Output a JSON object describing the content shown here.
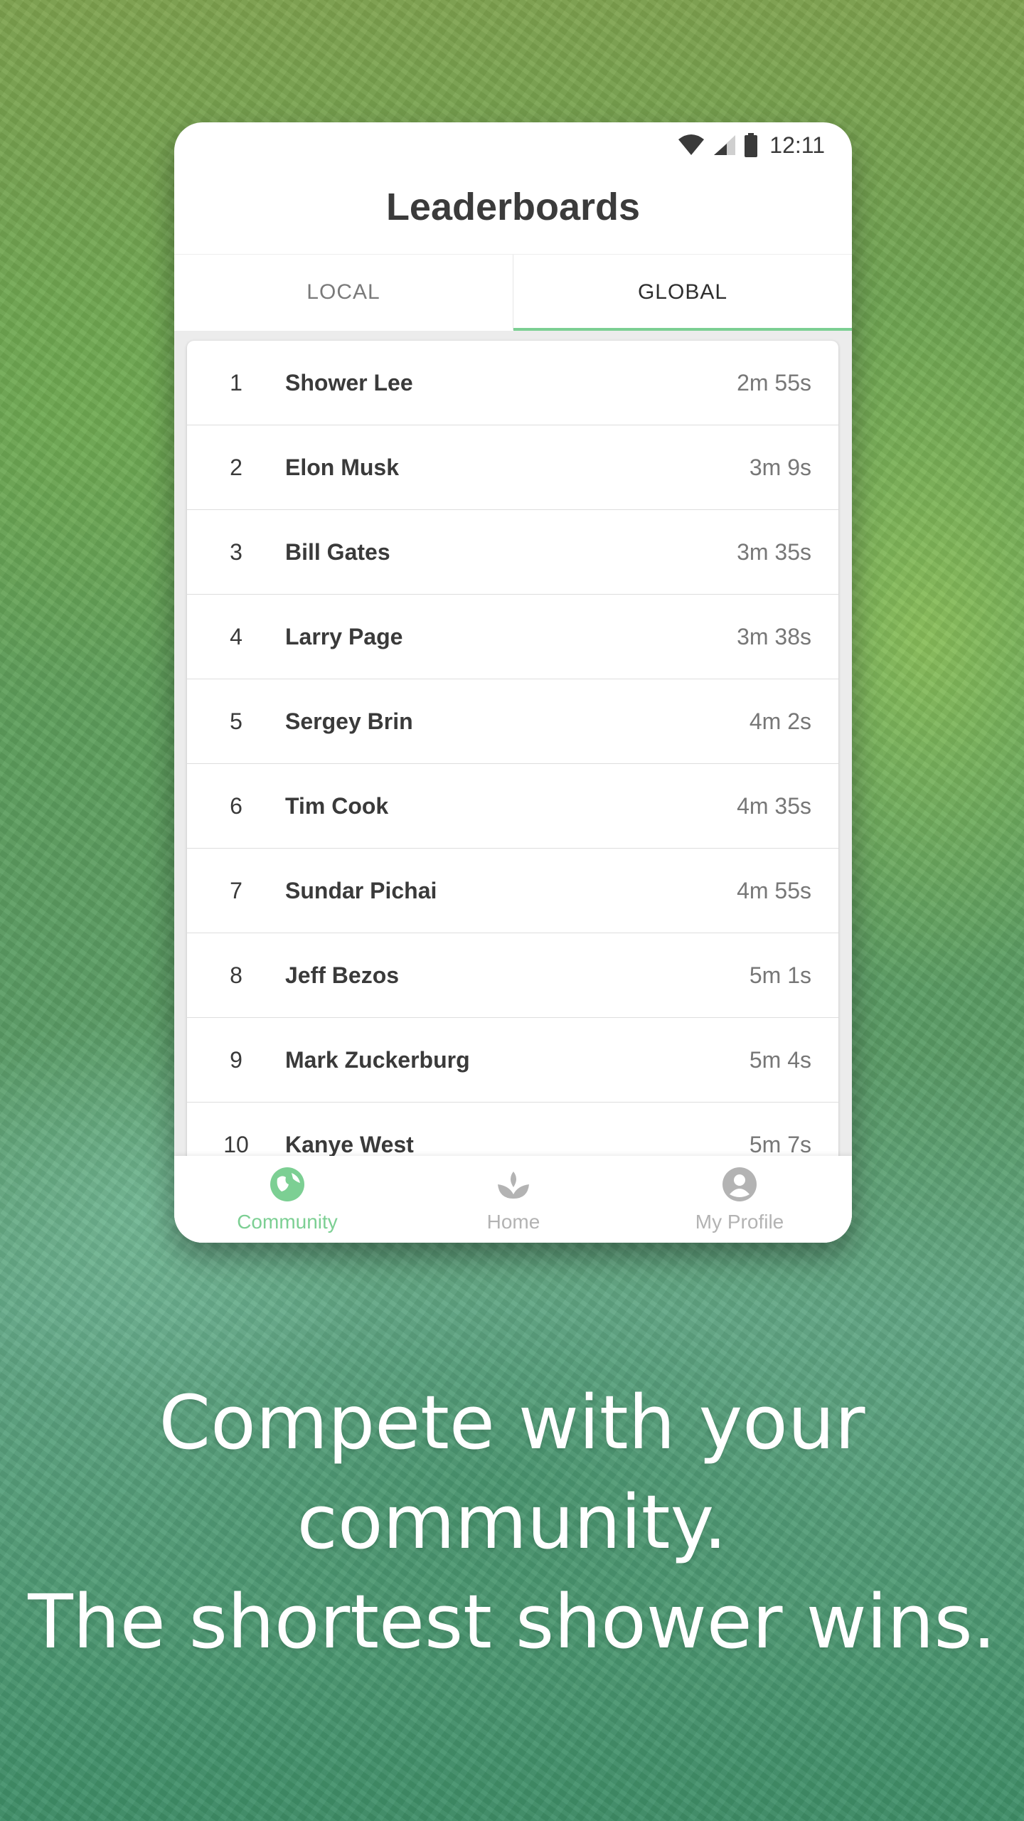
{
  "status_bar": {
    "time": "12:11"
  },
  "header": {
    "title": "Leaderboards"
  },
  "tabs": [
    {
      "label": "LOCAL",
      "active": false
    },
    {
      "label": "GLOBAL",
      "active": true
    }
  ],
  "leaderboard": [
    {
      "rank": "1",
      "name": "Shower Lee",
      "time": "2m 55s"
    },
    {
      "rank": "2",
      "name": "Elon Musk",
      "time": "3m 9s"
    },
    {
      "rank": "3",
      "name": "Bill Gates",
      "time": "3m 35s"
    },
    {
      "rank": "4",
      "name": "Larry Page",
      "time": "3m 38s"
    },
    {
      "rank": "5",
      "name": "Sergey Brin",
      "time": "4m 2s"
    },
    {
      "rank": "6",
      "name": "Tim Cook",
      "time": "4m 35s"
    },
    {
      "rank": "7",
      "name": "Sundar Pichai",
      "time": "4m 55s"
    },
    {
      "rank": "8",
      "name": "Jeff Bezos",
      "time": "5m 1s"
    },
    {
      "rank": "9",
      "name": "Mark Zuckerburg",
      "time": "5m 4s"
    },
    {
      "rank": "10",
      "name": "Kanye West",
      "time": "5m 7s"
    }
  ],
  "bottom_nav": [
    {
      "label": "Community",
      "icon": "globe-icon",
      "active": true
    },
    {
      "label": "Home",
      "icon": "sprout-icon",
      "active": false
    },
    {
      "label": "My Profile",
      "icon": "profile-icon",
      "active": false
    }
  ],
  "tagline": {
    "line1": "Compete with your",
    "line2": "community.",
    "line3": "The shortest shower wins."
  },
  "colors": {
    "accent": "#7ccf93",
    "inactive": "#b3b3b3"
  }
}
